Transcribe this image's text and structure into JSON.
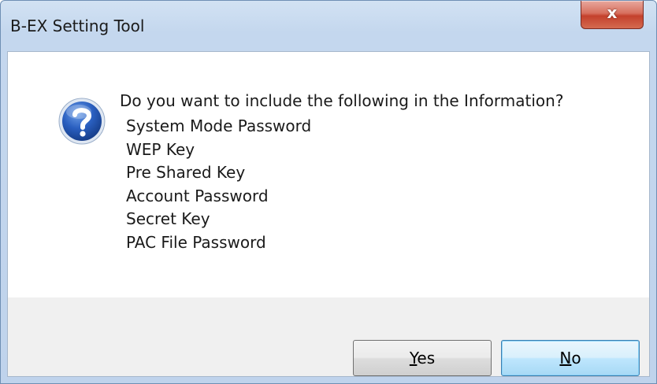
{
  "window": {
    "title": "B-EX Setting Tool",
    "close_glyph": "x"
  },
  "message": {
    "text": "Do you want to include the following in the Information?",
    "icon": "question-icon",
    "items": [
      "System Mode Password",
      "WEP Key",
      "Pre Shared Key",
      "Account Password",
      "Secret Key",
      "PAC File Password"
    ]
  },
  "buttons": {
    "yes_accel": "Y",
    "yes_rest": "es",
    "no_accel": "N",
    "no_rest": "o"
  },
  "colors": {
    "titlebar": "#c4d7ee",
    "close_button": "#c4412c",
    "dialog_body": "#ffffff",
    "button_bar": "#f0f0f0",
    "default_button_border": "#3c7fb1"
  }
}
